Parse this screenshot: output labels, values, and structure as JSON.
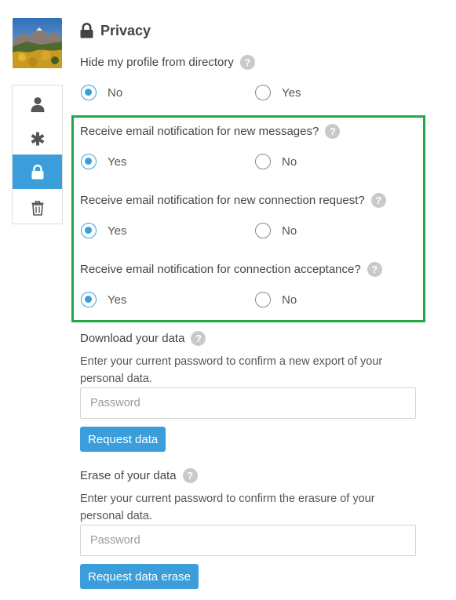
{
  "section": {
    "title": "Privacy",
    "icon": "lock-icon"
  },
  "sidenav": {
    "items": [
      {
        "icon": "user-icon",
        "active": false
      },
      {
        "icon": "asterisk-icon",
        "active": false
      },
      {
        "icon": "lock-icon",
        "active": true
      },
      {
        "icon": "trash-icon",
        "active": false
      }
    ]
  },
  "help_glyph": "?",
  "fields": [
    {
      "label": "Hide my profile from directory",
      "options": [
        "No",
        "Yes"
      ],
      "selected": "No"
    },
    {
      "label": "Receive email notification for new messages?",
      "options": [
        "Yes",
        "No"
      ],
      "selected": "Yes"
    },
    {
      "label": "Receive email notification for new connection request?",
      "options": [
        "Yes",
        "No"
      ],
      "selected": "Yes"
    },
    {
      "label": "Receive email notification for connection acceptance?",
      "options": [
        "Yes",
        "No"
      ],
      "selected": "Yes"
    }
  ],
  "download": {
    "heading": "Download your data",
    "description": "Enter your current password to confirm a new export of your personal data.",
    "placeholder": "Password",
    "button": "Request data"
  },
  "erase": {
    "heading": "Erase of your data",
    "description": "Enter your current password to confirm the erasure of your personal data.",
    "placeholder": "Password",
    "button": "Request data erase"
  },
  "colors": {
    "accent": "#3b9edb",
    "highlight_border": "#22a84a",
    "help_bg": "#c9c9c9"
  }
}
